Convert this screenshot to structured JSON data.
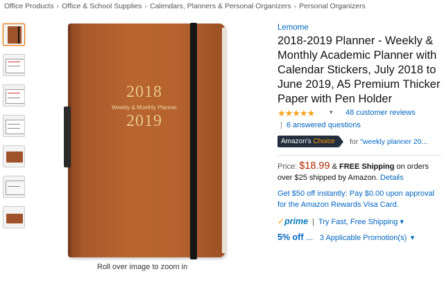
{
  "breadcrumb": [
    "Office Products",
    "Office & School Supplies",
    "Calendars, Planners & Personal Organizers",
    "Personal Organizers"
  ],
  "breadcrumb_sep": "›",
  "product_image": {
    "year_top": "2018",
    "subtitle": "Weekly & Monthly Planner",
    "year_bottom": "2019",
    "zoom_hint": "Roll over image to zoom in"
  },
  "product": {
    "brand": "Lemome",
    "title": "2018-2019 Planner - Weekly & Monthly Academic Planner with Calendar Stickers, July 2018 to June 2019, A5 Premium Thicker Paper with Pen Holder",
    "stars": "★★★★★",
    "rating_caret": "▾",
    "reviews": "48 customer reviews",
    "answered_sep": "|",
    "answered": "6 answered questions",
    "choice_prefix": "Amazon's",
    "choice_word": "Choice",
    "choice_for_prefix": "for",
    "choice_for_term": "\"weekly planner 20...",
    "price_label": "Price:",
    "price": "$18.99",
    "ship_amp": " & ",
    "free_shipping": "FREE Shipping",
    "ship_rest": " on orders over $25 shipped by Amazon.",
    "details": "Details",
    "promo": "Get $50 off instantly: Pay $0.00 upon approval for the Amazon Rewards Visa Card.",
    "prime_check": "✓",
    "prime": "prime",
    "prime_sep": "|",
    "prime_text": "Try Fast, Free Shipping",
    "prime_caret": "▾",
    "off": "5% off",
    "off_dots": "...",
    "promotions": "3 Applicable Promotion(s)",
    "promotions_caret": "▾"
  },
  "colors": {
    "link": "#0066c0",
    "price": "#b12704",
    "star": "#f4a41a",
    "cover": "#b5622e",
    "badge": "#232f3e",
    "accent": "#ff9900"
  }
}
